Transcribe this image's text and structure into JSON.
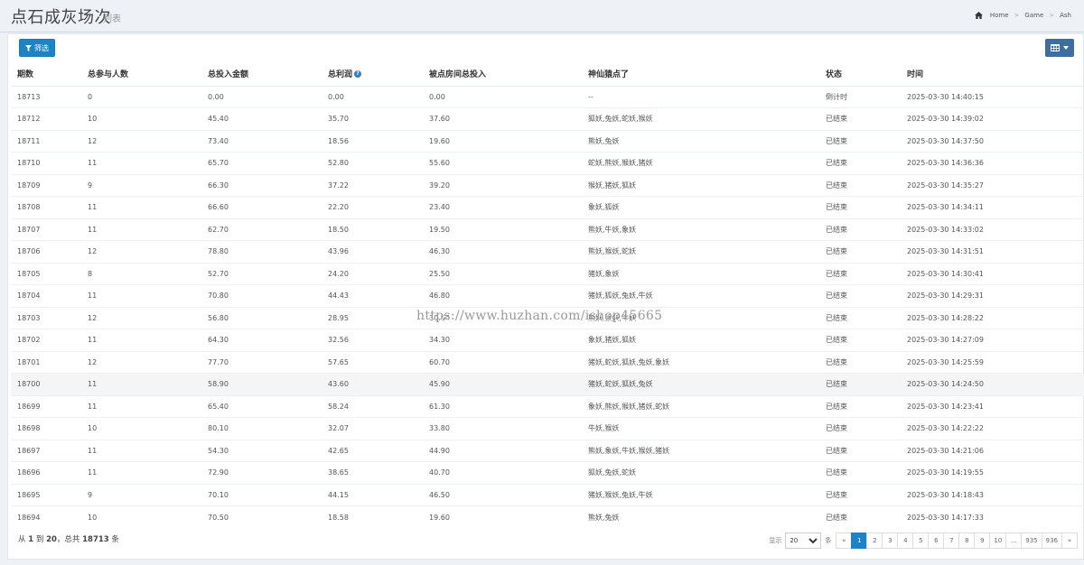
{
  "header": {
    "title": "点石成灰场次",
    "subtitle": "列表",
    "breadcrumb": [
      "Home",
      "Game",
      "Ash"
    ]
  },
  "toolbar": {
    "filter_label": "筛选"
  },
  "table": {
    "columns": [
      "期数",
      "总参与人数",
      "总投入金额",
      "总利润",
      "被点房间总投入",
      "神仙猿点了",
      "状态",
      "时间"
    ],
    "rows": [
      [
        "18713",
        "0",
        "0.00",
        "0.00",
        "0.00",
        "--",
        "倒计时",
        "2025-03-30 14:40:15"
      ],
      [
        "18712",
        "10",
        "45.40",
        "35.70",
        "37.60",
        "狐妖,兔妖,蛇妖,猴妖",
        "已结束",
        "2025-03-30 14:39:02"
      ],
      [
        "18711",
        "12",
        "73.40",
        "18.56",
        "19.60",
        "熊妖,兔妖",
        "已结束",
        "2025-03-30 14:37:50"
      ],
      [
        "18710",
        "11",
        "65.70",
        "52.80",
        "55.60",
        "蛇妖,熊妖,猴妖,猪妖",
        "已结束",
        "2025-03-30 14:36:36"
      ],
      [
        "18709",
        "9",
        "66.30",
        "37.22",
        "39.20",
        "猴妖,猪妖,狐妖",
        "已结束",
        "2025-03-30 14:35:27"
      ],
      [
        "18708",
        "11",
        "66.60",
        "22.20",
        "23.40",
        "象妖,狐妖",
        "已结束",
        "2025-03-30 14:34:11"
      ],
      [
        "18707",
        "11",
        "62.70",
        "18.50",
        "19.50",
        "熊妖,牛妖,象妖",
        "已结束",
        "2025-03-30 14:33:02"
      ],
      [
        "18706",
        "12",
        "78.80",
        "43.96",
        "46.30",
        "熊妖,猴妖,蛇妖",
        "已结束",
        "2025-03-30 14:31:51"
      ],
      [
        "18705",
        "8",
        "52.70",
        "24.20",
        "25.50",
        "猪妖,象妖",
        "已结束",
        "2025-03-30 14:30:41"
      ],
      [
        "18704",
        "11",
        "70.80",
        "44.43",
        "46.80",
        "猪妖,狐妖,兔妖,牛妖",
        "已结束",
        "2025-03-30 14:29:31"
      ],
      [
        "18703",
        "12",
        "56.80",
        "28.95",
        "30.50",
        "熊妖,猴妖,牛妖",
        "已结束",
        "2025-03-30 14:28:22"
      ],
      [
        "18702",
        "11",
        "64.30",
        "32.56",
        "34.30",
        "象妖,猪妖,狐妖",
        "已结束",
        "2025-03-30 14:27:09"
      ],
      [
        "18701",
        "12",
        "77.70",
        "57.65",
        "60.70",
        "猪妖,蛇妖,狐妖,兔妖,象妖",
        "已结束",
        "2025-03-30 14:25:59"
      ],
      [
        "18700",
        "11",
        "58.90",
        "43.60",
        "45.90",
        "猪妖,蛇妖,狐妖,兔妖",
        "已结束",
        "2025-03-30 14:24:50"
      ],
      [
        "18699",
        "11",
        "65.40",
        "58.24",
        "61.30",
        "象妖,熊妖,猴妖,猪妖,蛇妖",
        "已结束",
        "2025-03-30 14:23:41"
      ],
      [
        "18698",
        "10",
        "80.10",
        "32.07",
        "33.80",
        "牛妖,猴妖",
        "已结束",
        "2025-03-30 14:22:22"
      ],
      [
        "18697",
        "11",
        "54.30",
        "42.65",
        "44.90",
        "熊妖,象妖,牛妖,猴妖,猪妖",
        "已结束",
        "2025-03-30 14:21:06"
      ],
      [
        "18696",
        "11",
        "72.90",
        "38.65",
        "40.70",
        "狐妖,兔妖,蛇妖",
        "已结束",
        "2025-03-30 14:19:55"
      ],
      [
        "18695",
        "9",
        "70.10",
        "44.15",
        "46.50",
        "猪妖,猴妖,兔妖,牛妖",
        "已结束",
        "2025-03-30 14:18:43"
      ],
      [
        "18694",
        "10",
        "70.50",
        "18.58",
        "19.60",
        "熊妖,兔妖",
        "已结束",
        "2025-03-30 14:17:33"
      ]
    ],
    "highlighted_row": 13
  },
  "footer": {
    "summary_prefix": "从",
    "summary_from": "1",
    "summary_to_word": "到",
    "summary_to": "20",
    "summary_total_word": "，总共",
    "summary_total": "18713",
    "summary_unit": "条",
    "show_label": "显示",
    "page_size": "20",
    "page_size_unit": "条",
    "pages": [
      "«",
      "1",
      "2",
      "3",
      "4",
      "5",
      "6",
      "7",
      "8",
      "9",
      "10",
      "...",
      "935",
      "936",
      "»"
    ],
    "active_page": "1"
  },
  "watermark": "https://www.huzhan.com/ishop45665",
  "colors": {
    "primary": "#1c84c6",
    "columns_button": "#3c6e9f",
    "help_icon": "#3a7cc1"
  },
  "icons": {
    "home": "home-icon",
    "filter": "filter-icon",
    "columns": "columns-icon",
    "help": "question-circle-icon"
  }
}
